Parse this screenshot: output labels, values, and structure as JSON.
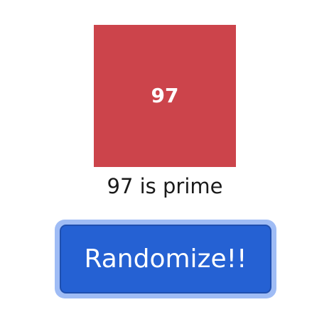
{
  "number": {
    "value": "97",
    "color": "#cc444b"
  },
  "result": {
    "text": "97 is prime"
  },
  "button": {
    "label": "Randomize!!",
    "color": "#2561d3",
    "focus_ring_color": "#9fbcf5"
  }
}
